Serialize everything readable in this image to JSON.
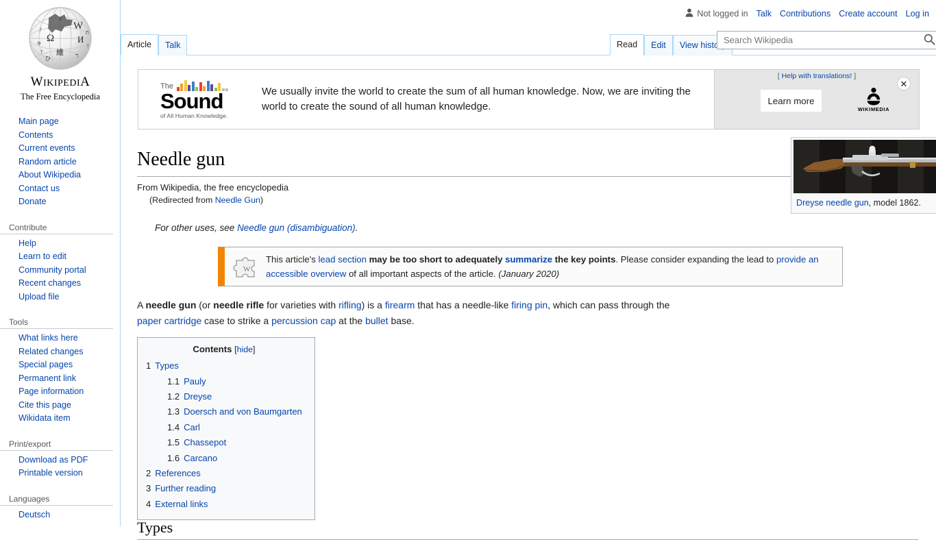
{
  "site": {
    "wordmark_main": "WIKIPEDIA",
    "wordmark_sub": "The Free Encyclopedia"
  },
  "personal_nav": {
    "status": "Not logged in",
    "links": [
      {
        "label": "Talk"
      },
      {
        "label": "Contributions"
      },
      {
        "label": "Create account"
      },
      {
        "label": "Log in"
      }
    ]
  },
  "sidebar": {
    "portals": [
      {
        "heading": "",
        "items": [
          {
            "label": "Main page"
          },
          {
            "label": "Contents"
          },
          {
            "label": "Current events"
          },
          {
            "label": "Random article"
          },
          {
            "label": "About Wikipedia"
          },
          {
            "label": "Contact us"
          },
          {
            "label": "Donate"
          }
        ]
      },
      {
        "heading": "Contribute",
        "items": [
          {
            "label": "Help"
          },
          {
            "label": "Learn to edit"
          },
          {
            "label": "Community portal"
          },
          {
            "label": "Recent changes"
          },
          {
            "label": "Upload file"
          }
        ]
      },
      {
        "heading": "Tools",
        "items": [
          {
            "label": "What links here"
          },
          {
            "label": "Related changes"
          },
          {
            "label": "Special pages"
          },
          {
            "label": "Permanent link"
          },
          {
            "label": "Page information"
          },
          {
            "label": "Cite this page"
          },
          {
            "label": "Wikidata item"
          }
        ]
      },
      {
        "heading": "Print/export",
        "items": [
          {
            "label": "Download as PDF"
          },
          {
            "label": "Printable version"
          }
        ]
      },
      {
        "heading": "Languages",
        "has_gear": true,
        "items": [
          {
            "label": "Deutsch"
          }
        ]
      }
    ]
  },
  "tabs": {
    "namespace": [
      {
        "label": "Article",
        "selected": true
      },
      {
        "label": "Talk",
        "selected": false
      }
    ],
    "views": [
      {
        "label": "Read",
        "selected": true
      },
      {
        "label": "Edit",
        "selected": false
      },
      {
        "label": "View history",
        "selected": false
      }
    ]
  },
  "search": {
    "placeholder": "Search Wikipedia",
    "value": "",
    "icon": "search-icon"
  },
  "banner": {
    "logo_the": "The",
    "logo_word": "Sound",
    "logo_tagline": "of All Human Knowledge.",
    "message": "We usually invite the world to create the sum of all human knowledge. Now, we are inviting the world to create the sound of all human knowledge.",
    "help_prefix": "[ ",
    "help_link": "Help with translations!",
    "help_suffix": " ]",
    "cta_label": "Learn more",
    "wikimedia_label": "WIKIMEDIA",
    "close_label": "✕",
    "equalizer_colors": [
      "#e8432b",
      "#f0a030",
      "#f5c542",
      "#5b4a9e",
      "#3f7fc1",
      "#8dc63f",
      "#e8432b",
      "#f0a030",
      "#3f7fc1",
      "#5b4a9e",
      "#8dc63f",
      "#f5c542",
      "#bcbec0",
      "#bcbec0"
    ],
    "equalizer_heights": [
      6,
      11,
      16,
      9,
      14,
      6,
      13,
      7,
      15,
      10,
      5,
      12,
      4,
      4
    ],
    "panel_bg": "#e6e6e6"
  },
  "article": {
    "title": "Needle gun",
    "site_sub": "From Wikipedia, the free encyclopedia",
    "redirect_prefix": "(Redirected from ",
    "redirect_target": "Needle Gun",
    "redirect_suffix": ")",
    "hatnote_prefix": "For other uses, see ",
    "hatnote_link": "Needle gun (disambiguation)",
    "hatnote_suffix": ".",
    "ambox": {
      "t1": "This article's ",
      "l1": "lead section",
      "b1": " may be too short to adequately ",
      "l2": "summarize",
      "b2": " the key points",
      "t2": ". Please consider expanding the lead to ",
      "l3": "provide an accessible overview",
      "t3": " of all important aspects of the article. ",
      "date": "(January 2020)"
    },
    "lead": {
      "p1": "A ",
      "b1": "needle gun",
      "p2": " (or ",
      "b2": "needle rifle",
      "p3": " for varieties with ",
      "l1": "rifling",
      "p4": ") is a ",
      "l2": "firearm",
      "p5": " that has a needle-like ",
      "l3": "firing pin",
      "p6": ", which can pass through the ",
      "l4": "paper cartridge",
      "p7": " case to strike a ",
      "l5": "percussion cap",
      "p8": " at the ",
      "l6": "bullet",
      "p9": " base."
    },
    "next_section_heading": "Types"
  },
  "toc": {
    "title": "Contents",
    "toggle_open": "[",
    "toggle_label": "hide",
    "toggle_close": "]",
    "entries": [
      {
        "number": "1",
        "label": "Types",
        "level": 1
      },
      {
        "number": "1.1",
        "label": "Pauly",
        "level": 2
      },
      {
        "number": "1.2",
        "label": "Dreyse",
        "level": 2
      },
      {
        "number": "1.3",
        "label": "Doersch and von Baumgarten",
        "level": 2
      },
      {
        "number": "1.4",
        "label": "Carl",
        "level": 2
      },
      {
        "number": "1.5",
        "label": "Chassepot",
        "level": 2
      },
      {
        "number": "1.6",
        "label": "Carcano",
        "level": 2
      },
      {
        "number": "2",
        "label": "References",
        "level": 1
      },
      {
        "number": "3",
        "label": "Further reading",
        "level": 1
      },
      {
        "number": "4",
        "label": "External links",
        "level": 1
      }
    ]
  },
  "thumbnail": {
    "caption_link": "Dreyse needle gun",
    "caption_rest": ", model 1862.",
    "magnify_icon": "enlarge-icon"
  },
  "colors": {
    "link": "#0645ad",
    "border_blue": "#a7d7f9",
    "ambox_accent": "#f28500",
    "text": "#202122",
    "muted": "#54595d"
  }
}
